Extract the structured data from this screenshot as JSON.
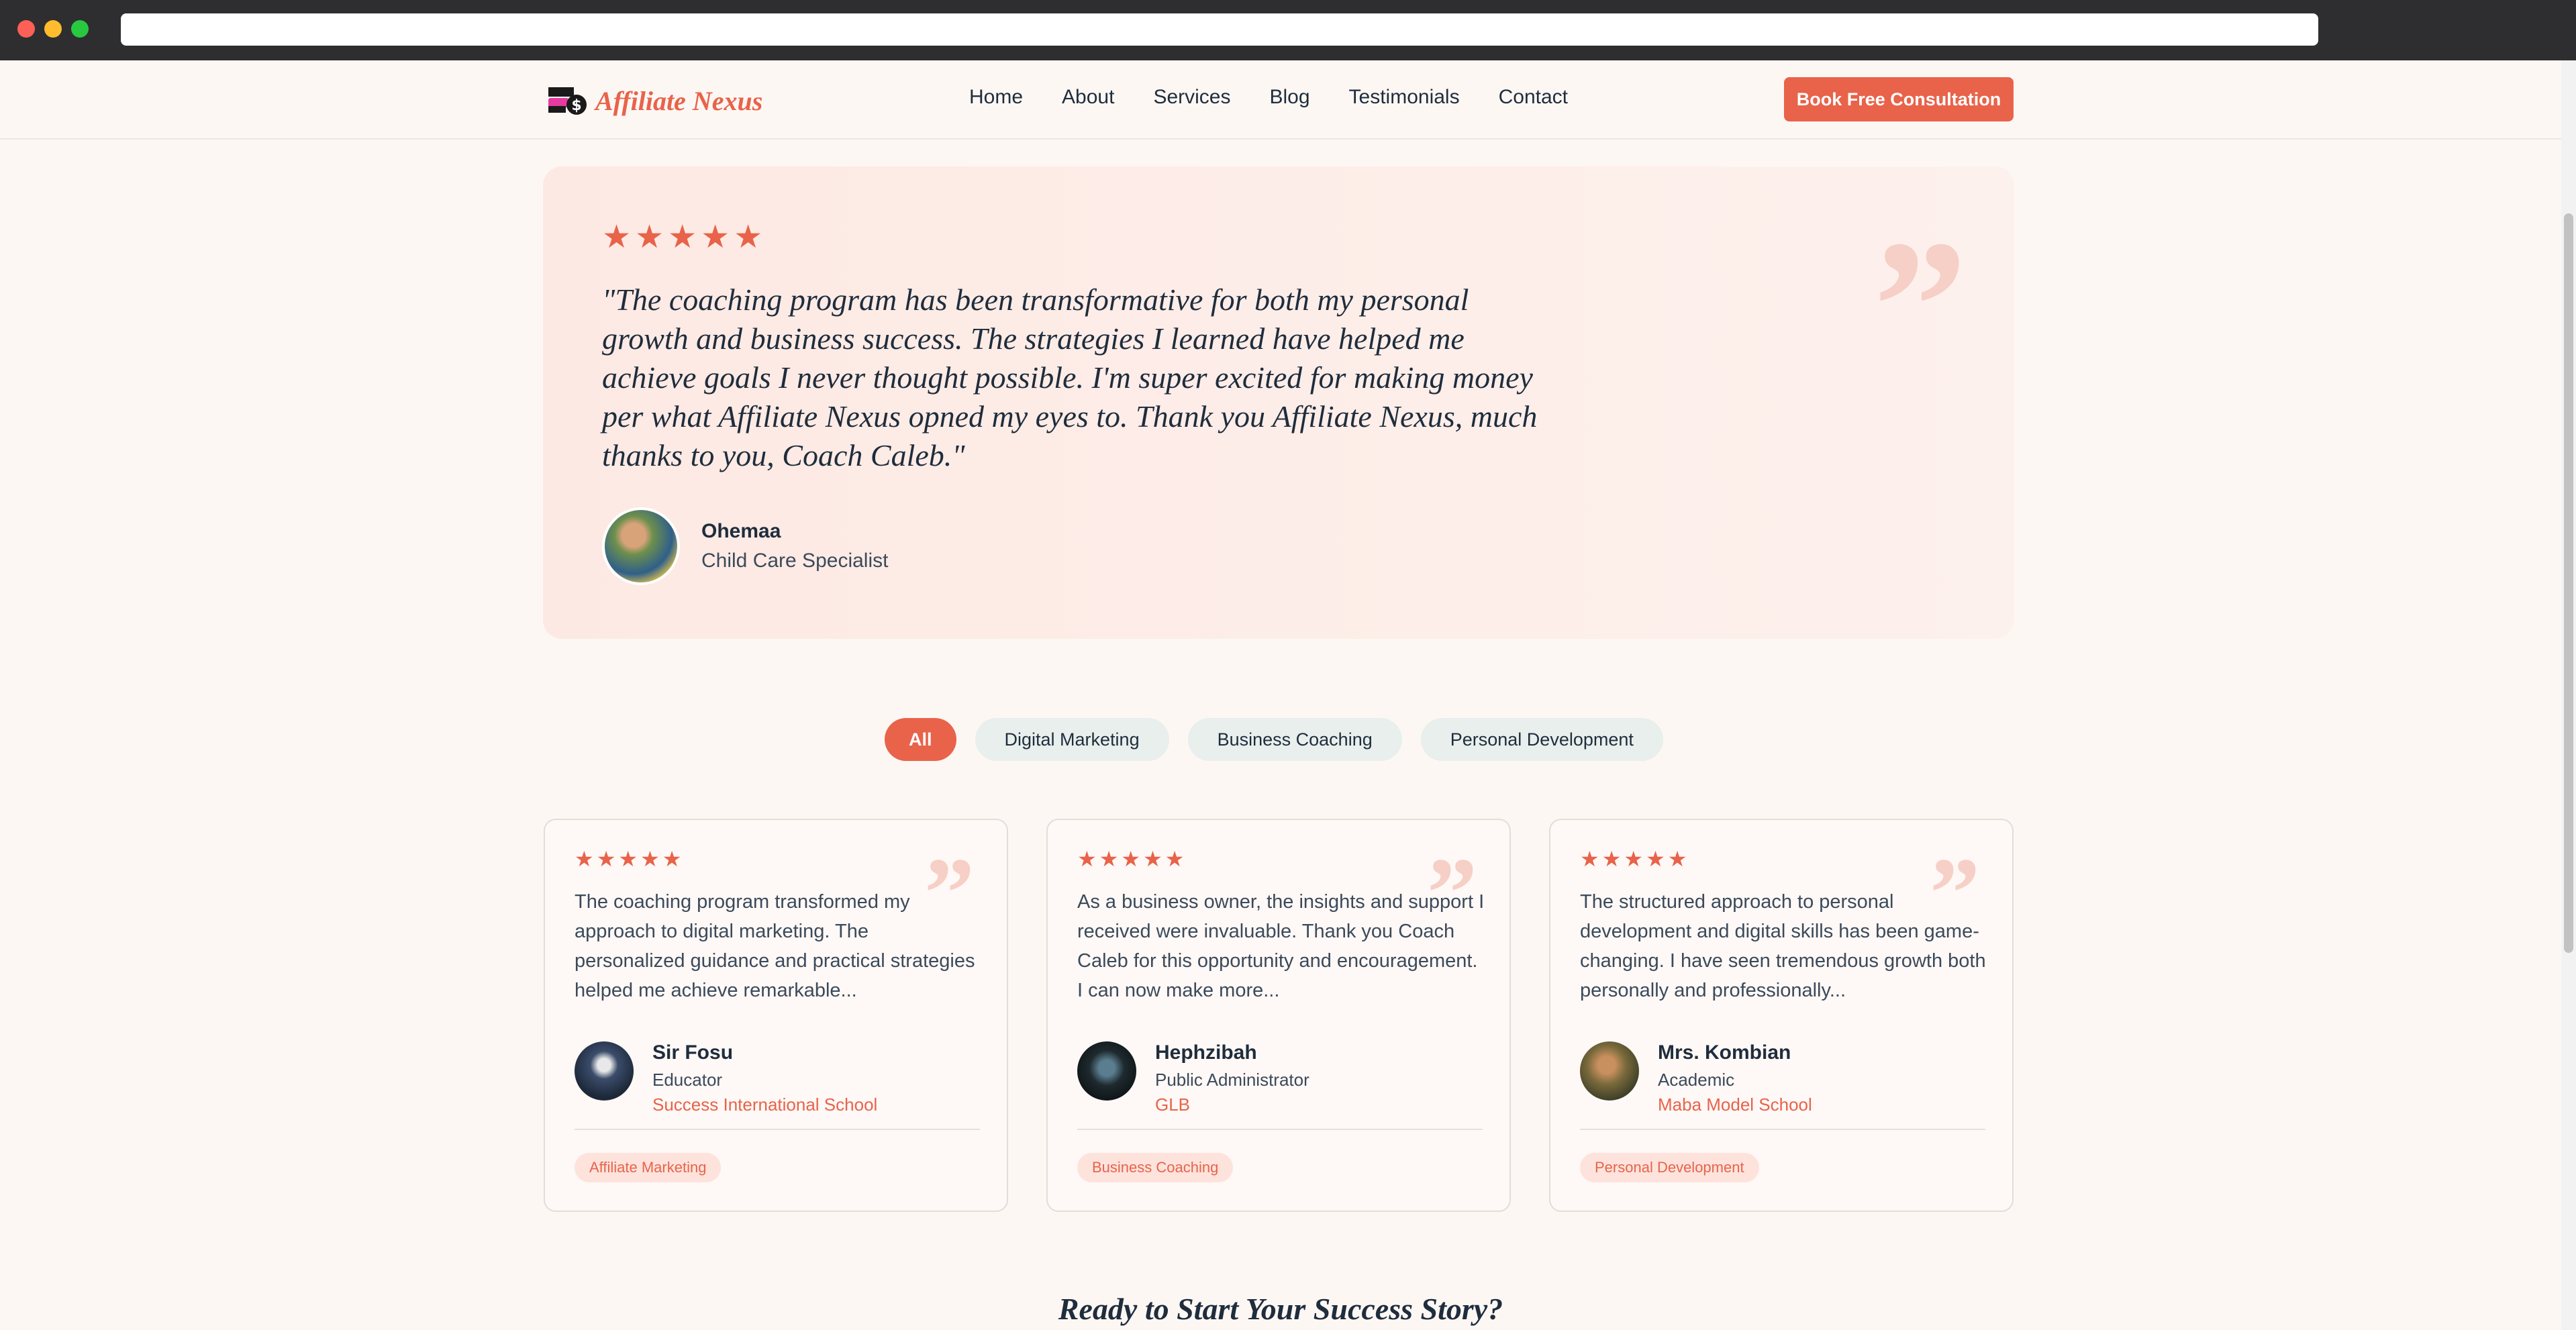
{
  "brand": {
    "name": "Affiliate Nexus",
    "accent": "#e8634a"
  },
  "nav": {
    "links": [
      "Home",
      "About",
      "Services",
      "Blog",
      "Testimonials",
      "Contact"
    ],
    "cta": "Book Free Consultation"
  },
  "featured": {
    "rating": 5,
    "quote": "\"The coaching program has been transformative for both my personal growth and business success. The strategies I learned have helped me achieve goals I never thought possible. I'm super excited for making money per what Affiliate Nexus opned my eyes to. Thank you Affiliate Nexus, much thanks to you, Coach Caleb.\"",
    "author": "Ohemaa",
    "role": "Child Care Specialist"
  },
  "filters": [
    "All",
    "Digital Marketing",
    "Business Coaching",
    "Personal Development"
  ],
  "cards": [
    {
      "rating": 5,
      "text": "The coaching program transformed my approach to digital marketing. The personalized guidance and practical strategies helped me achieve remarkable...",
      "name": "Sir Fosu",
      "role": "Educator",
      "org": "Success International School",
      "tag": "Affiliate Marketing"
    },
    {
      "rating": 5,
      "text": "As a business owner, the insights and support I received were invaluable. Thank you Coach Caleb for this opportunity and encouragement. I can now make more...",
      "name": "Hephzibah",
      "role": "Public Administrator",
      "org": "GLB",
      "tag": "Business Coaching"
    },
    {
      "rating": 5,
      "text": "The structured approach to personal development and digital skills has been game-changing. I have seen tremendous growth both personally and professionally...",
      "name": "Mrs. Kombian",
      "role": "Academic",
      "org": "Maba Model School",
      "tag": "Personal Development"
    }
  ],
  "cta_section": {
    "heading": "Ready to Start Your Success Story?"
  }
}
